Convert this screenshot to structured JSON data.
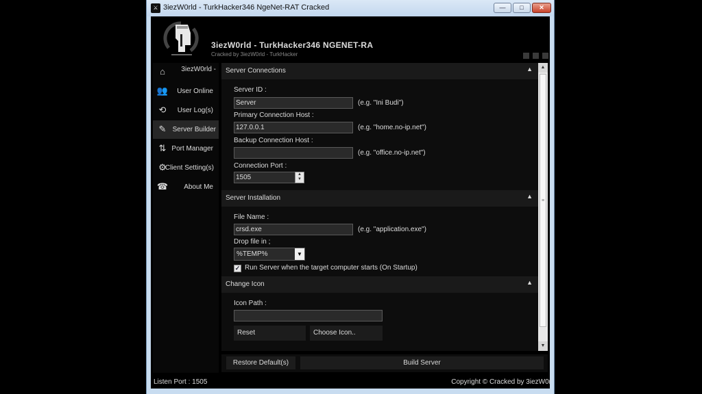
{
  "window": {
    "title": "3iezW0rld - TurkHacker346 NgeNet-RAT Cracked",
    "min_glyph": "—",
    "max_glyph": "□",
    "close_glyph": "✕"
  },
  "header": {
    "title": "3iezW0rld - TurkHacker346 NGENET-RA",
    "subtitle": "Cracked by 3iezW0rld - TurkHacker"
  },
  "sidebar": {
    "items": [
      {
        "label": "3iezW0rld -",
        "icon": "⌂"
      },
      {
        "label": "User Online",
        "icon": "👥"
      },
      {
        "label": "User Log(s)",
        "icon": "⟲"
      },
      {
        "label": "Server Builder",
        "icon": "✎"
      },
      {
        "label": "Port Manager",
        "icon": "⇅"
      },
      {
        "label": "Client Setting(s)",
        "icon": "⚙"
      },
      {
        "label": "About Me",
        "icon": "☎"
      }
    ],
    "active_index": 3
  },
  "sections": {
    "connections": {
      "title": "Server Connections",
      "collapse": "▲",
      "server_id_label": "Server ID :",
      "server_id_value": "Server",
      "server_id_hint": "(e.g. \"Ini Budi\")",
      "primary_label": "Primary Connection Host :",
      "primary_value": "127.0.0.1",
      "primary_hint": "(e.g. \"home.no-ip.net\")",
      "backup_label": "Backup Connection Host :",
      "backup_value": "",
      "backup_hint": "(e.g. \"office.no-ip.net\")",
      "port_label": "Connection Port :",
      "port_value": "1505"
    },
    "installation": {
      "title": "Server Installation",
      "collapse": "▲",
      "file_label": "File Name :",
      "file_value": "crsd.exe",
      "file_hint": "(e.g. \"application.exe\")",
      "drop_label": "Drop file in ;",
      "drop_value": "%TEMP%",
      "startup_label": "Run Server when the target computer starts (On Startup)",
      "startup_checked": true
    },
    "icon": {
      "title": "Change Icon",
      "collapse": "▲",
      "path_label": "Icon Path :",
      "path_value": "",
      "reset_label": "Reset",
      "choose_label": "Choose Icon.."
    }
  },
  "actions": {
    "restore_label": "Restore Default(s)",
    "build_label": "Build Server"
  },
  "status": {
    "listen": "Listen Port : 1505",
    "copyright": "Copyright © Cracked by 3iezW0r"
  }
}
